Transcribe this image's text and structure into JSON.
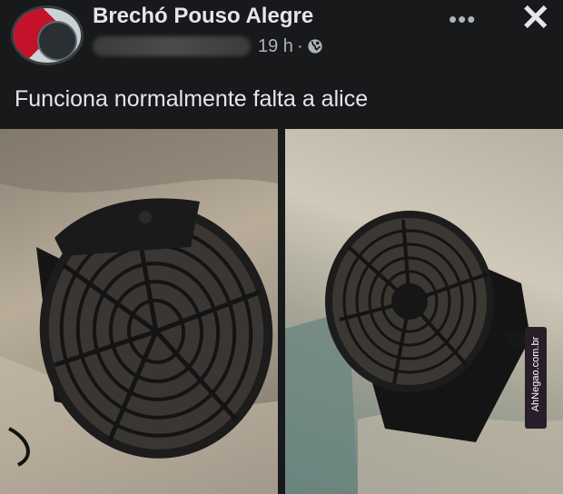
{
  "post": {
    "page_name": "Brechó Pouso Alegre",
    "time": "19 h",
    "separator": "·",
    "privacy_icon": "globe-icon",
    "caption": "Funciona normalmente falta a alice"
  },
  "toolbar": {
    "more_label": "•••",
    "close_label": "✕"
  },
  "photos": [
    {
      "subject": "fan-left"
    },
    {
      "subject": "fan-right"
    }
  ],
  "watermark": {
    "text": "AhNegao.com.br"
  },
  "colors": {
    "background": "#18191a",
    "text_primary": "#e4e6eb",
    "text_secondary": "#b0b3b8",
    "fan_body": "#1c1c1c"
  }
}
